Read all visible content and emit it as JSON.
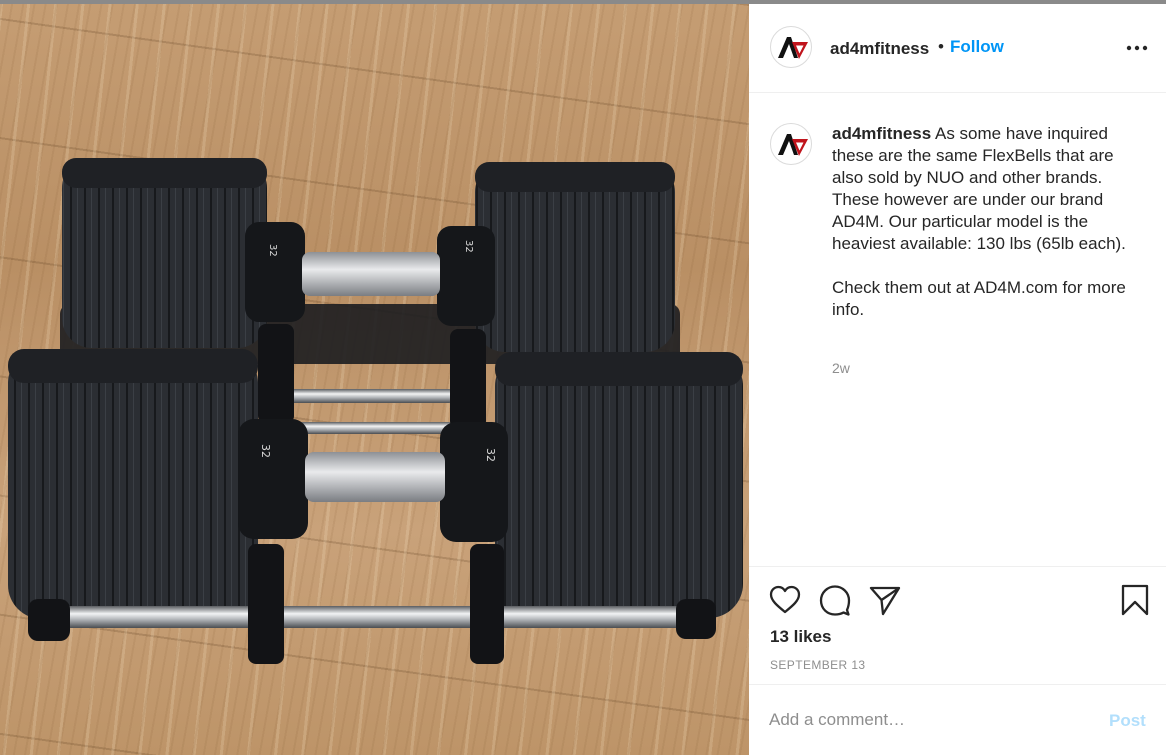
{
  "post": {
    "username": "ad4mfitness",
    "separator": "•",
    "follow_label": "Follow",
    "caption_text": " As some have inquired these are the same FlexBells that are also sold by NUO and other brands. These however are under our brand AD4M. Our particular model is the heaviest available: 130 lbs (65lb each).\n\nCheck them out at AD4M.com for more info.",
    "time_ago": "2w",
    "likes": "13 likes",
    "date": "SEPTEMBER 13"
  },
  "comment": {
    "placeholder": "Add a comment…",
    "post_label": "Post"
  },
  "photo": {
    "dumbbell_weight_marks": [
      "32",
      "32",
      "32",
      "32"
    ]
  },
  "icons": {
    "avatar_logo": "ad4m-logo",
    "more": "more-options-icon",
    "like": "heart-icon",
    "comment": "comment-icon",
    "share": "share-icon",
    "save": "bookmark-icon"
  },
  "colors": {
    "follow_blue": "#0095f6",
    "post_disabled": "#b2dffc",
    "logo_red": "#c0141c",
    "muted_text": "#8e8e8e"
  }
}
